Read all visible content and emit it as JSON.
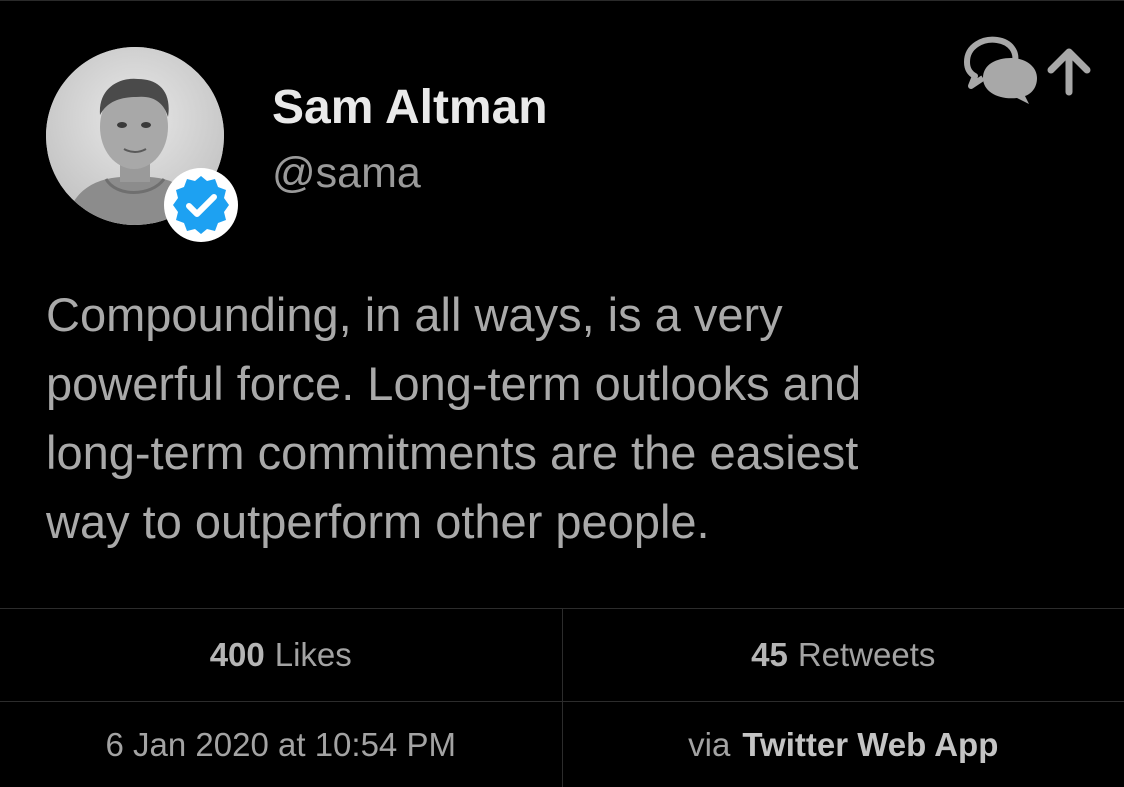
{
  "colors": {
    "background": "#000000",
    "name_text": "#e9e9e9",
    "body_text": "#a9a9a9",
    "muted_text": "#9a9a9a",
    "divider": "#2c2c2c",
    "verified_blue": "#1da1f2"
  },
  "author": {
    "name": "Sam Altman",
    "handle": "@sama",
    "avatar_icon": "profile-photo",
    "verified_icon": "verified-badge-icon"
  },
  "actions": {
    "reply_icon": "reply-bubbles-icon",
    "share_icon": "share-arrow-icon"
  },
  "tweet": {
    "text": "Compounding, in all ways, is a very\npowerful force.  Long-term outlooks and\nlong-term commitments are the easiest\nway to outperform other people."
  },
  "stats": {
    "likes_count": "400",
    "likes_label": "Likes",
    "retweets_count": "45",
    "retweets_label": "Retweets"
  },
  "meta": {
    "timestamp": "6 Jan 2020 at 10:54 PM",
    "via_prefix": "via",
    "source_app": "Twitter Web App"
  }
}
